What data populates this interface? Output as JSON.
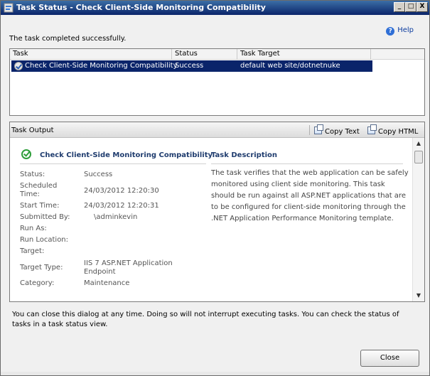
{
  "window": {
    "title": "Task Status - Check Client-Side Monitoring Compatibility",
    "minimize": "_",
    "maximize": "□",
    "close": "X"
  },
  "message": "The task completed successfully.",
  "help": "Help",
  "task_list": {
    "columns": [
      "Task",
      "Status",
      "Task Target"
    ],
    "rows": [
      {
        "task": "Check Client-Side Monitoring Compatibility",
        "status": "Success",
        "target": "default web site/dotnetnuke"
      }
    ]
  },
  "output": {
    "label": "Task Output",
    "copy_text": "Copy Text",
    "copy_html": "Copy HTML",
    "task_title": "Check Client-Side Monitoring Compatibility",
    "desc_title": "Task Description",
    "description": "The task verifies that the web application can be safely monitored using client side monitoring. This task should be run against all ASP.NET applications that are to be configured for client-side monitoring through the .NET Application Performance Monitoring template.",
    "properties": [
      {
        "label": "Status:",
        "value": "Success"
      },
      {
        "label": "Scheduled Time:",
        "value": "24/03/2012 12:20:30"
      },
      {
        "label": "Start Time:",
        "value": "24/03/2012 12:20:31"
      },
      {
        "label": "Submitted By:",
        "value": "\\adminkevin"
      },
      {
        "label": "Run As:",
        "value": ""
      },
      {
        "label": "Run Location:",
        "value": ""
      },
      {
        "label": "Target:",
        "value": ""
      },
      {
        "label": "Target Type:",
        "value": "IIS 7 ASP.NET Application Endpoint"
      },
      {
        "label": "Category:",
        "value": "Maintenance"
      }
    ]
  },
  "footer": "You can close this dialog at any time. Doing so will not interrupt executing tasks. You can check the status of tasks in a task status view.",
  "close_button": "Close",
  "icons": [
    "app-icon",
    "help-icon",
    "success-icon",
    "copy-text-icon",
    "copy-html-icon",
    "scroll-up-icon",
    "scroll-down-icon"
  ]
}
